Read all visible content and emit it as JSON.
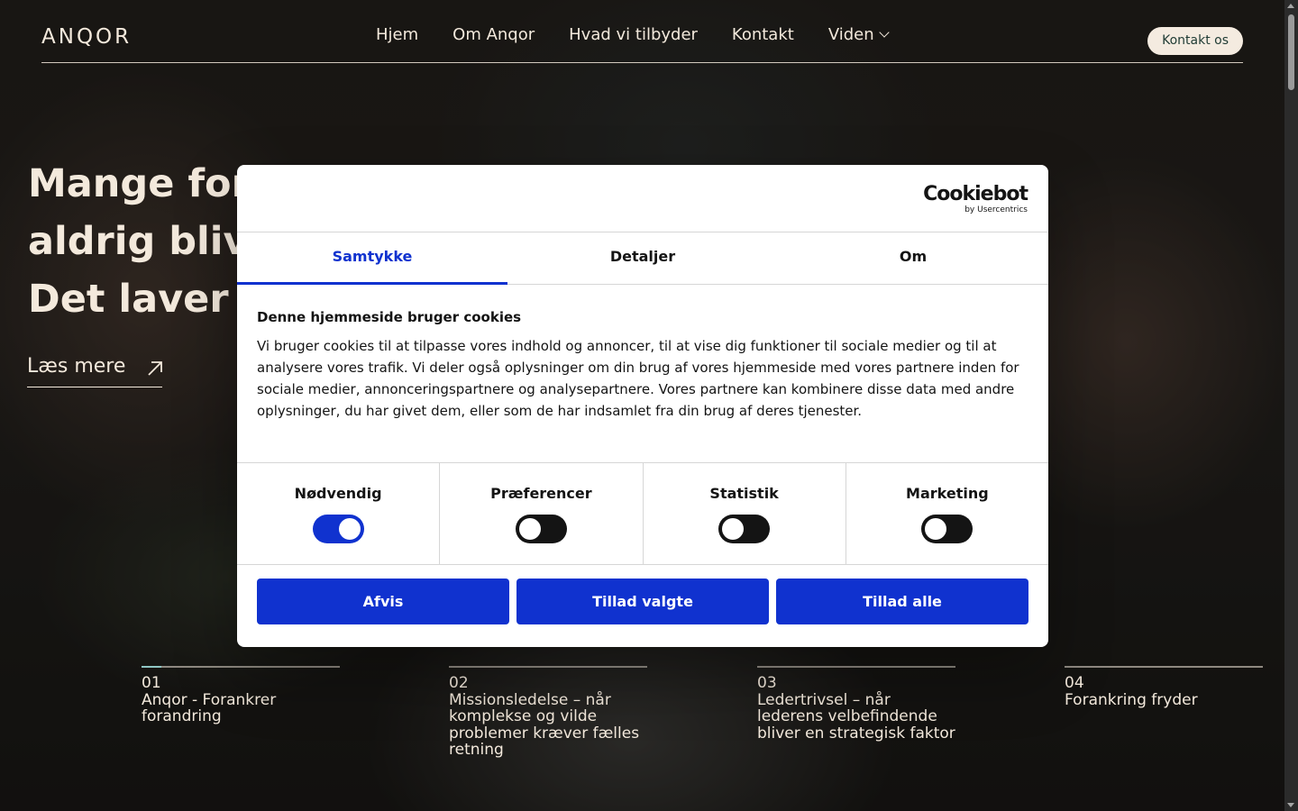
{
  "header": {
    "logo": "ANQOR",
    "nav": [
      "Hjem",
      "Om Anqor",
      "Hvad vi tilbyder",
      "Kontakt",
      "Viden"
    ],
    "contact_label": "Kontakt os"
  },
  "hero": {
    "title_lines": [
      "Mange fora",
      "aldrig blive",
      "Det laver v"
    ],
    "read_more": "Læs mere"
  },
  "slides": [
    {
      "num": "01",
      "title": "Anqor - Forankrer forandring"
    },
    {
      "num": "02",
      "title": "Missionsledelse – når komplekse og vilde problemer kræver fælles retning"
    },
    {
      "num": "03",
      "title": "Ledertrivsel – når lederens velbefindende bliver en strategisk faktor"
    },
    {
      "num": "04",
      "title": "Forankring fryder"
    }
  ],
  "cookie": {
    "brand": "Cookiebot",
    "brand_sub": "by Usercentrics",
    "tabs": [
      "Samtykke",
      "Detaljer",
      "Om"
    ],
    "heading": "Denne hjemmeside bruger cookies",
    "text": "Vi bruger cookies til at tilpasse vores indhold og annoncer, til at vise dig funktioner til sociale medier og til at analysere vores trafik. Vi deler også oplysninger om din brug af vores hjemmeside med vores partnere inden for sociale medier, annonceringspartnere og analysepartnere. Vores partnere kan kombinere disse data med andre oplysninger, du har givet dem, eller som de har indsamlet fra din brug af deres tjenester.",
    "toggles": [
      {
        "label": "Nødvendig",
        "on": true
      },
      {
        "label": "Præferencer",
        "on": false
      },
      {
        "label": "Statistik",
        "on": false
      },
      {
        "label": "Marketing",
        "on": false
      }
    ],
    "buttons": [
      "Afvis",
      "Tillad valgte",
      "Tillad alle"
    ]
  },
  "colors": {
    "accent": "#1032cf",
    "cream": "#f3e9dc",
    "button_bg": "#f4ebe0"
  }
}
